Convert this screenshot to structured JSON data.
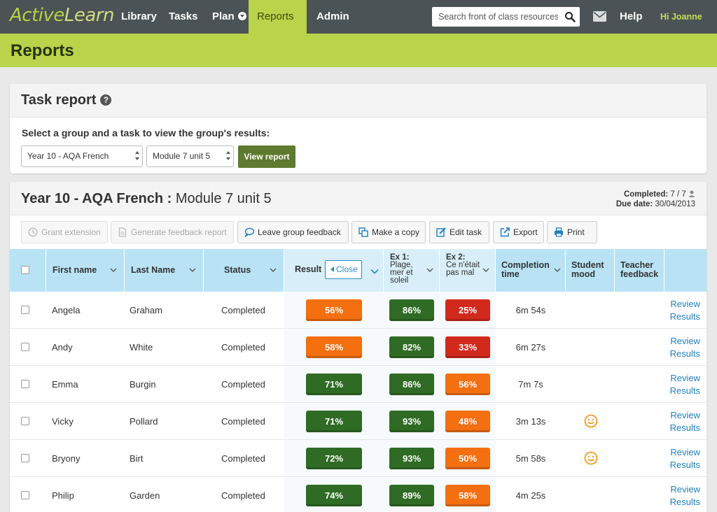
{
  "nav": {
    "logo_active": "Active",
    "logo_learn": "Learn",
    "items": [
      {
        "label": "Library"
      },
      {
        "label": "Tasks"
      },
      {
        "label": "Plan"
      },
      {
        "label": "Reports"
      },
      {
        "label": "Admin"
      }
    ],
    "search_placeholder": "Search front of class resources",
    "help": "Help",
    "greeting": "Hi Joanne"
  },
  "page_title": "Reports",
  "task_report": {
    "title": "Task report",
    "prompt": "Select a group and a task to view the group's results:",
    "group_select": "Year 10 - AQA French",
    "task_select": "Module 7 unit 5",
    "view_button": "View report"
  },
  "report": {
    "group": "Year 10 - AQA French",
    "separator": ":",
    "task": "Module 7 unit 5",
    "completed_label": "Completed:",
    "completed_value": "7 / 7",
    "due_label": "Due date:",
    "due_value": "30/04/2013",
    "toolbar": {
      "grant_extension": "Grant extension",
      "generate_feedback": "Generate feedback report",
      "leave_feedback": "Leave group feedback",
      "make_copy": "Make a copy",
      "edit_task": "Edit task",
      "export": "Export",
      "print": "Print"
    },
    "columns": {
      "first_name": "First name",
      "last_name": "Last Name",
      "status": "Status",
      "result": "Result",
      "close": "Close",
      "ex1_label": "Ex 1:",
      "ex1_title": "Plage, mer et soleil",
      "ex2_label": "Ex 2:",
      "ex2_title": "Ce n'était pas mal",
      "completion_time": "Completion time",
      "student_mood": "Student mood",
      "teacher_feedback": "Teacher feedback"
    },
    "review_line1": "Review",
    "review_line2": "Results",
    "rows": [
      {
        "first": "Angela",
        "last": "Graham",
        "status": "Completed",
        "result": "56%",
        "ex1": "86%",
        "ex2": "25%",
        "time": "6m 54s",
        "mood": ""
      },
      {
        "first": "Andy",
        "last": "White",
        "status": "Completed",
        "result": "58%",
        "ex1": "82%",
        "ex2": "33%",
        "time": "6m 27s",
        "mood": ""
      },
      {
        "first": "Emma",
        "last": "Burgin",
        "status": "Completed",
        "result": "71%",
        "ex1": "86%",
        "ex2": "56%",
        "time": "7m 7s",
        "mood": ""
      },
      {
        "first": "Vicky",
        "last": "Pollard",
        "status": "Completed",
        "result": "71%",
        "ex1": "93%",
        "ex2": "48%",
        "time": "3m 13s",
        "mood": "smile-icon"
      },
      {
        "first": "Bryony",
        "last": "Birt",
        "status": "Completed",
        "result": "72%",
        "ex1": "93%",
        "ex2": "50%",
        "time": "5m 58s",
        "mood": "smile-icon"
      },
      {
        "first": "Philip",
        "last": "Garden",
        "status": "Completed",
        "result": "74%",
        "ex1": "89%",
        "ex2": "58%",
        "time": "4m 25s",
        "mood": ""
      }
    ]
  },
  "colors": {
    "brand_green": "#b9d34b",
    "nav_dark": "#4b5356",
    "score_green": "#2f6b25",
    "score_orange": "#f36f10",
    "score_red": "#d1291c",
    "table_header": "#b9e3f5",
    "link_blue": "#1f7fc0"
  }
}
